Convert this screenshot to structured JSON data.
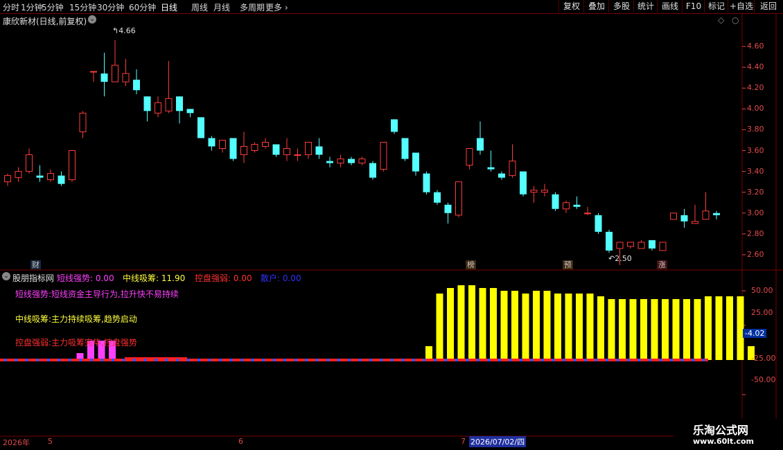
{
  "toolbar": {
    "periods": [
      "分时",
      "1分钟",
      "5分钟",
      "15分钟",
      "30分钟",
      "60分钟",
      "日线",
      "周线",
      "月线",
      "多周期",
      "更多"
    ],
    "active_period": "日线",
    "right_buttons": [
      "复权",
      "叠加",
      "多股",
      "统计",
      "画线",
      "F10",
      "标记",
      "+自选",
      "返回"
    ]
  },
  "chart_title": "康欣新材(日线,前复权)",
  "price_axis": [
    "4.60",
    "4.40",
    "4.20",
    "4.00",
    "3.80",
    "3.60",
    "3.40",
    "3.20",
    "3.00",
    "2.80",
    "2.60"
  ],
  "high_label": "4.66",
  "low_label": "2.50",
  "markers": [
    {
      "text": "财",
      "color": "#7ec8ff"
    },
    {
      "text": "榜",
      "color": "#ffb060"
    },
    {
      "text": "预",
      "color": "#ffb060"
    },
    {
      "text": "涨",
      "color": "#ff8080"
    }
  ],
  "indicator": {
    "name": "股朋指标网",
    "fields": [
      {
        "label": "短线强势:",
        "value": "0.00",
        "color": "#ff40ff"
      },
      {
        "label": "中线吸筹:",
        "value": "11.90",
        "color": "#ffff40"
      },
      {
        "label": "控盘强弱:",
        "value": "0.00",
        "color": "#ff3030"
      },
      {
        "label": "散户:",
        "value": "0.00",
        "color": "#3030ff"
      }
    ],
    "legend_short": "短线强势:短线资金主导行为,拉升快不易持续",
    "legend_mid": "中线吸筹:主力持续吸筹,趋势启动",
    "legend_ctrl": "控盘强弱:主力吸筹完毕,控盘强势",
    "axis": [
      "50.00",
      "25.00",
      "-4.02",
      "-25.00",
      "-50.00"
    ],
    "current_value": "-4.02"
  },
  "date_axis": {
    "year": "2026年",
    "months": [
      "5",
      "6",
      "7"
    ],
    "cursor_date": "2026/07/02/四"
  },
  "watermark": {
    "line1": "乐淘公式网",
    "line2": "www.60lt.com"
  },
  "colors": {
    "up": "#ff3c3c",
    "down": "#54ffff",
    "grid": "#7a0000",
    "magenta": "#ff40ff",
    "yellow": "#ffff00",
    "blue": "#3050ff",
    "red": "#ff2020"
  },
  "chart_data": {
    "type": "candlestick",
    "price_range": [
      2.48,
      4.78
    ],
    "candles": [
      [
        3.3,
        3.36,
        3.38,
        3.26
      ],
      [
        3.34,
        3.4,
        3.44,
        3.3
      ],
      [
        3.4,
        3.56,
        3.62,
        3.38
      ],
      [
        3.36,
        3.34,
        3.46,
        3.3
      ],
      [
        3.32,
        3.38,
        3.42,
        3.3
      ],
      [
        3.36,
        3.28,
        3.4,
        3.26
      ],
      [
        3.32,
        3.6,
        3.6,
        3.3
      ],
      [
        3.78,
        3.96,
        3.98,
        3.72
      ],
      [
        4.36,
        4.36,
        4.36,
        4.26
      ],
      [
        4.34,
        4.26,
        4.54,
        4.12
      ],
      [
        4.26,
        4.42,
        4.66,
        4.26
      ],
      [
        4.26,
        4.34,
        4.48,
        4.22
      ],
      [
        4.28,
        4.18,
        4.38,
        4.14
      ],
      [
        4.12,
        3.98,
        4.12,
        3.88
      ],
      [
        3.96,
        4.06,
        4.12,
        3.92
      ],
      [
        3.98,
        4.1,
        4.46,
        3.96
      ],
      [
        4.12,
        3.98,
        4.12,
        3.86
      ],
      [
        4.0,
        3.96,
        4.0,
        3.92
      ],
      [
        3.92,
        3.72,
        3.92,
        3.72
      ],
      [
        3.72,
        3.64,
        3.74,
        3.6
      ],
      [
        3.62,
        3.7,
        3.7,
        3.58
      ],
      [
        3.72,
        3.52,
        3.72,
        3.5
      ],
      [
        3.56,
        3.64,
        3.78,
        3.48
      ],
      [
        3.6,
        3.66,
        3.68,
        3.58
      ],
      [
        3.64,
        3.68,
        3.72,
        3.62
      ],
      [
        3.66,
        3.56,
        3.66,
        3.54
      ],
      [
        3.56,
        3.62,
        3.72,
        3.5
      ],
      [
        3.56,
        3.56,
        3.62,
        3.5
      ],
      [
        3.56,
        3.68,
        3.68,
        3.52
      ],
      [
        3.64,
        3.56,
        3.72,
        3.52
      ],
      [
        3.5,
        3.48,
        3.54,
        3.44
      ],
      [
        3.48,
        3.52,
        3.56,
        3.44
      ],
      [
        3.52,
        3.48,
        3.54,
        3.46
      ],
      [
        3.48,
        3.52,
        3.54,
        3.46
      ],
      [
        3.48,
        3.34,
        3.5,
        3.32
      ],
      [
        3.42,
        3.68,
        3.68,
        3.4
      ],
      [
        3.9,
        3.78,
        3.9,
        3.76
      ],
      [
        3.72,
        3.52,
        3.72,
        3.5
      ],
      [
        3.58,
        3.4,
        3.58,
        3.36
      ],
      [
        3.38,
        3.2,
        3.4,
        3.18
      ],
      [
        3.2,
        3.1,
        3.22,
        3.08
      ],
      [
        3.08,
        3.0,
        3.1,
        2.9
      ],
      [
        2.98,
        3.3,
        3.3,
        2.96
      ],
      [
        3.46,
        3.62,
        3.62,
        3.42
      ],
      [
        3.72,
        3.6,
        3.88,
        3.56
      ],
      [
        3.44,
        3.42,
        3.6,
        3.4
      ],
      [
        3.38,
        3.34,
        3.4,
        3.32
      ],
      [
        3.36,
        3.5,
        3.66,
        3.34
      ],
      [
        3.4,
        3.18,
        3.4,
        3.16
      ],
      [
        3.2,
        3.22,
        3.26,
        3.1
      ],
      [
        3.2,
        3.22,
        3.28,
        3.16
      ],
      [
        3.18,
        3.04,
        3.2,
        3.02
      ],
      [
        3.04,
        3.1,
        3.12,
        3.0
      ],
      [
        3.08,
        3.06,
        3.16,
        3.04
      ],
      [
        3.0,
        3.0,
        3.06,
        2.98
      ],
      [
        2.98,
        2.82,
        3.0,
        2.8
      ],
      [
        2.82,
        2.64,
        2.84,
        2.62
      ],
      [
        2.66,
        2.72,
        2.72,
        2.5
      ],
      [
        2.68,
        2.72,
        2.72,
        2.66
      ],
      [
        2.66,
        2.72,
        2.74,
        2.66
      ],
      [
        2.74,
        2.66,
        2.74,
        2.64
      ],
      [
        2.64,
        2.72,
        2.72,
        2.64
      ],
      [
        2.94,
        3.0,
        3.0,
        2.94
      ],
      [
        2.98,
        2.92,
        3.04,
        2.86
      ],
      [
        2.9,
        2.92,
        3.08,
        2.9
      ],
      [
        2.94,
        3.02,
        3.2,
        2.94
      ],
      [
        3.0,
        2.98,
        3.02,
        2.94
      ]
    ],
    "indicator_range": [
      -50,
      60
    ],
    "yellow_bars": [
      0,
      0,
      0,
      0,
      0,
      0,
      0,
      0,
      0,
      0,
      0,
      0,
      0,
      0,
      0,
      0,
      0,
      0,
      0,
      0,
      0,
      0,
      0,
      0,
      0,
      0,
      0,
      0,
      0,
      0,
      0,
      0,
      0,
      0,
      0,
      0,
      0,
      0,
      0,
      0,
      10,
      48,
      52,
      54,
      54,
      52,
      52,
      50,
      50,
      48,
      50,
      50,
      48,
      48,
      48,
      48,
      46,
      44,
      44,
      44,
      44,
      44,
      44,
      44,
      44,
      44,
      46,
      46,
      46,
      46,
      10
    ],
    "magenta_bars": [
      0,
      0,
      0,
      0,
      0,
      0,
      0,
      5,
      14,
      14,
      14,
      0,
      0,
      0,
      0
    ],
    "red_line": 0
  }
}
